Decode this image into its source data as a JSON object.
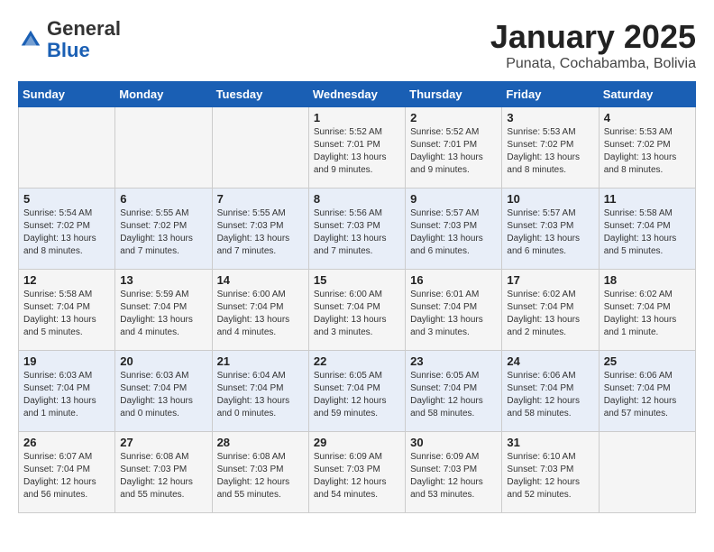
{
  "header": {
    "logo_general": "General",
    "logo_blue": "Blue",
    "month_title": "January 2025",
    "location": "Punata, Cochabamba, Bolivia"
  },
  "weekdays": [
    "Sunday",
    "Monday",
    "Tuesday",
    "Wednesday",
    "Thursday",
    "Friday",
    "Saturday"
  ],
  "weeks": [
    [
      {
        "day": "",
        "info": ""
      },
      {
        "day": "",
        "info": ""
      },
      {
        "day": "",
        "info": ""
      },
      {
        "day": "1",
        "info": "Sunrise: 5:52 AM\nSunset: 7:01 PM\nDaylight: 13 hours and 9 minutes."
      },
      {
        "day": "2",
        "info": "Sunrise: 5:52 AM\nSunset: 7:01 PM\nDaylight: 13 hours and 9 minutes."
      },
      {
        "day": "3",
        "info": "Sunrise: 5:53 AM\nSunset: 7:02 PM\nDaylight: 13 hours and 8 minutes."
      },
      {
        "day": "4",
        "info": "Sunrise: 5:53 AM\nSunset: 7:02 PM\nDaylight: 13 hours and 8 minutes."
      }
    ],
    [
      {
        "day": "5",
        "info": "Sunrise: 5:54 AM\nSunset: 7:02 PM\nDaylight: 13 hours and 8 minutes."
      },
      {
        "day": "6",
        "info": "Sunrise: 5:55 AM\nSunset: 7:02 PM\nDaylight: 13 hours and 7 minutes."
      },
      {
        "day": "7",
        "info": "Sunrise: 5:55 AM\nSunset: 7:03 PM\nDaylight: 13 hours and 7 minutes."
      },
      {
        "day": "8",
        "info": "Sunrise: 5:56 AM\nSunset: 7:03 PM\nDaylight: 13 hours and 7 minutes."
      },
      {
        "day": "9",
        "info": "Sunrise: 5:57 AM\nSunset: 7:03 PM\nDaylight: 13 hours and 6 minutes."
      },
      {
        "day": "10",
        "info": "Sunrise: 5:57 AM\nSunset: 7:03 PM\nDaylight: 13 hours and 6 minutes."
      },
      {
        "day": "11",
        "info": "Sunrise: 5:58 AM\nSunset: 7:04 PM\nDaylight: 13 hours and 5 minutes."
      }
    ],
    [
      {
        "day": "12",
        "info": "Sunrise: 5:58 AM\nSunset: 7:04 PM\nDaylight: 13 hours and 5 minutes."
      },
      {
        "day": "13",
        "info": "Sunrise: 5:59 AM\nSunset: 7:04 PM\nDaylight: 13 hours and 4 minutes."
      },
      {
        "day": "14",
        "info": "Sunrise: 6:00 AM\nSunset: 7:04 PM\nDaylight: 13 hours and 4 minutes."
      },
      {
        "day": "15",
        "info": "Sunrise: 6:00 AM\nSunset: 7:04 PM\nDaylight: 13 hours and 3 minutes."
      },
      {
        "day": "16",
        "info": "Sunrise: 6:01 AM\nSunset: 7:04 PM\nDaylight: 13 hours and 3 minutes."
      },
      {
        "day": "17",
        "info": "Sunrise: 6:02 AM\nSunset: 7:04 PM\nDaylight: 13 hours and 2 minutes."
      },
      {
        "day": "18",
        "info": "Sunrise: 6:02 AM\nSunset: 7:04 PM\nDaylight: 13 hours and 1 minute."
      }
    ],
    [
      {
        "day": "19",
        "info": "Sunrise: 6:03 AM\nSunset: 7:04 PM\nDaylight: 13 hours and 1 minute."
      },
      {
        "day": "20",
        "info": "Sunrise: 6:03 AM\nSunset: 7:04 PM\nDaylight: 13 hours and 0 minutes."
      },
      {
        "day": "21",
        "info": "Sunrise: 6:04 AM\nSunset: 7:04 PM\nDaylight: 13 hours and 0 minutes."
      },
      {
        "day": "22",
        "info": "Sunrise: 6:05 AM\nSunset: 7:04 PM\nDaylight: 12 hours and 59 minutes."
      },
      {
        "day": "23",
        "info": "Sunrise: 6:05 AM\nSunset: 7:04 PM\nDaylight: 12 hours and 58 minutes."
      },
      {
        "day": "24",
        "info": "Sunrise: 6:06 AM\nSunset: 7:04 PM\nDaylight: 12 hours and 58 minutes."
      },
      {
        "day": "25",
        "info": "Sunrise: 6:06 AM\nSunset: 7:04 PM\nDaylight: 12 hours and 57 minutes."
      }
    ],
    [
      {
        "day": "26",
        "info": "Sunrise: 6:07 AM\nSunset: 7:04 PM\nDaylight: 12 hours and 56 minutes."
      },
      {
        "day": "27",
        "info": "Sunrise: 6:08 AM\nSunset: 7:03 PM\nDaylight: 12 hours and 55 minutes."
      },
      {
        "day": "28",
        "info": "Sunrise: 6:08 AM\nSunset: 7:03 PM\nDaylight: 12 hours and 55 minutes."
      },
      {
        "day": "29",
        "info": "Sunrise: 6:09 AM\nSunset: 7:03 PM\nDaylight: 12 hours and 54 minutes."
      },
      {
        "day": "30",
        "info": "Sunrise: 6:09 AM\nSunset: 7:03 PM\nDaylight: 12 hours and 53 minutes."
      },
      {
        "day": "31",
        "info": "Sunrise: 6:10 AM\nSunset: 7:03 PM\nDaylight: 12 hours and 52 minutes."
      },
      {
        "day": "",
        "info": ""
      }
    ]
  ]
}
